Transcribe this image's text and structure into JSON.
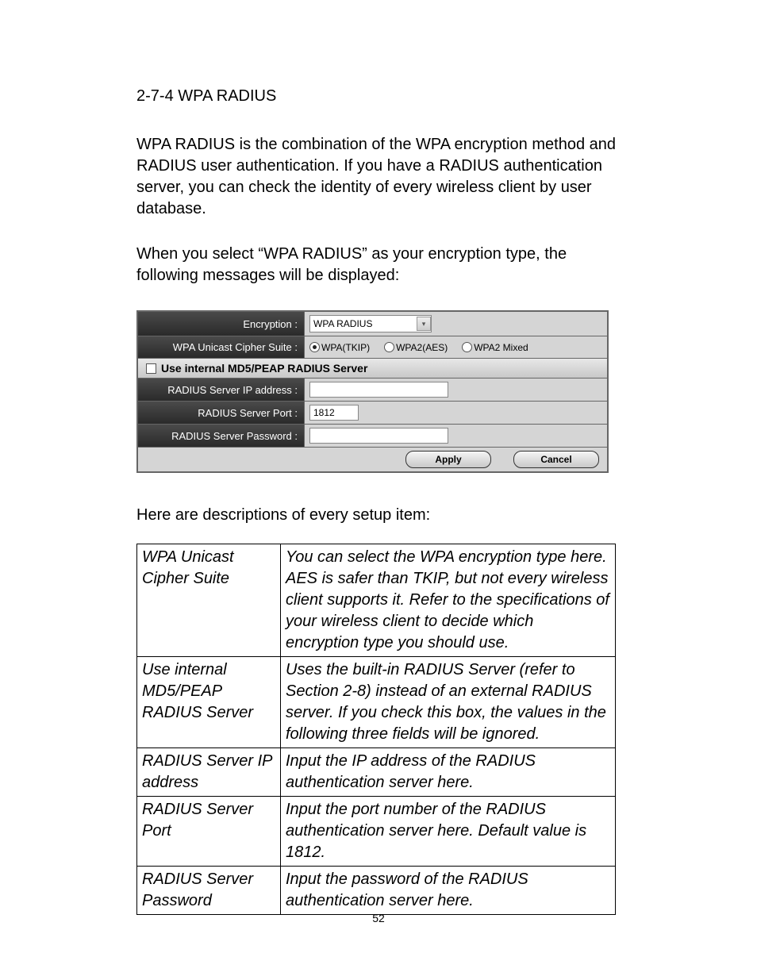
{
  "section_title": "2-7-4 WPA RADIUS",
  "para1": "WPA RADIUS is the combination of the WPA encryption method and RADIUS user authentication. If you have a RADIUS authentication server, you can check the identity of every wireless client by user database.",
  "para2": "When you select “WPA RADIUS” as your encryption type, the following messages will be displayed:",
  "panel": {
    "encryption_label": "Encryption :",
    "encryption_value": "WPA RADIUS",
    "cipher_label": "WPA Unicast Cipher Suite :",
    "cipher_options": {
      "wpa_tkip": "WPA(TKIP)",
      "wpa2_aes": "WPA2(AES)",
      "wpa2_mixed": "WPA2 Mixed"
    },
    "cipher_selected": "wpa_tkip",
    "use_internal_label": "Use internal MD5/PEAP RADIUS Server",
    "use_internal_checked": false,
    "ip_label": "RADIUS Server IP address :",
    "ip_value": "",
    "port_label": "RADIUS Server Port :",
    "port_value": "1812",
    "password_label": "RADIUS Server Password :",
    "password_value": "",
    "apply_label": "Apply",
    "cancel_label": "Cancel"
  },
  "desc_caption": "Here are descriptions of every setup item:",
  "desc_rows": [
    {
      "key": "WPA Unicast Cipher Suite",
      "val": "You can select the WPA encryption type here. AES is safer than TKIP, but not every wireless client supports it. Refer to the specifications of your wireless client to decide which encryption type you should use."
    },
    {
      "key": "Use internal MD5/PEAP RADIUS Server",
      "val": "Uses the built-in RADIUS Server (refer to Section 2-8) instead of an external RADIUS server. If you check this box, the values in the following three fields will be ignored."
    },
    {
      "key": "RADIUS Server IP address",
      "val": "Input the IP address of the RADIUS authentication server here."
    },
    {
      "key": "RADIUS Server Port",
      "val": "Input the port number of the RADIUS authentication server here. Default value is 1812."
    },
    {
      "key": "RADIUS Server Password",
      "val": "Input the password of the RADIUS authentication server here."
    }
  ],
  "page_number": "52"
}
